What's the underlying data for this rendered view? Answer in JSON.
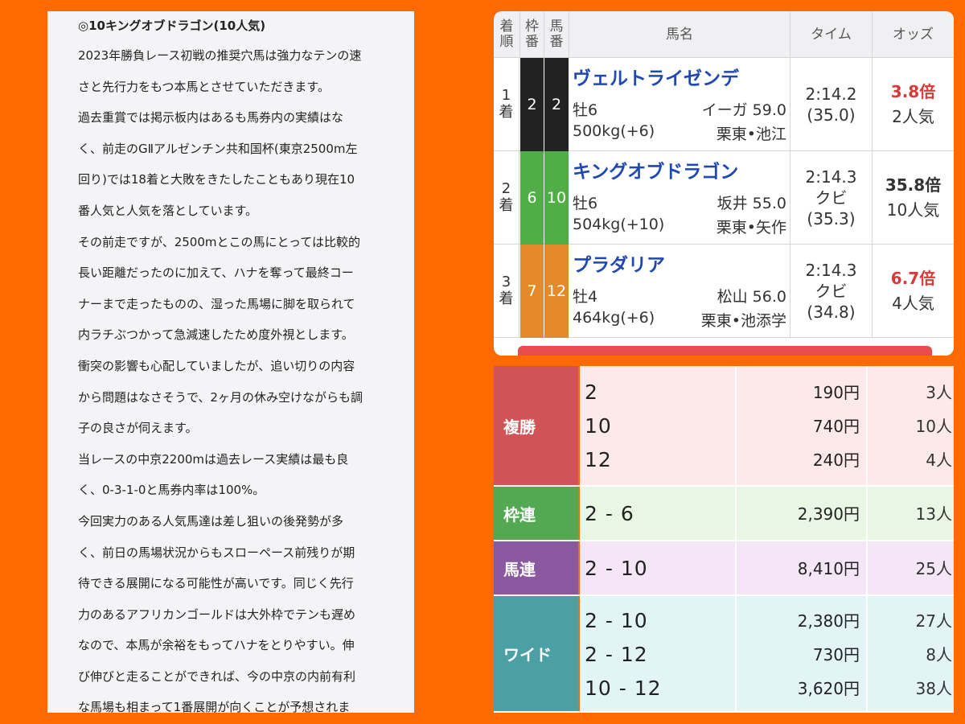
{
  "article": {
    "title": "◎10キングオブドラゴン(10人気)",
    "lines": [
      "2023年勝負レース初戦の推奨穴馬は強力なテンの速",
      "さと先行力をもつ本馬とさせていただきます。",
      "過去重賞では掲示板内はあるも馬券内の実績はな",
      "く、前走のGⅡアルゼンチン共和国杯(東京2500m左",
      "回り)では18着と大敗をきたしたこともあり現在10",
      "番人気と人気を落としています。",
      "その前走ですが、2500mとこの馬にとっては比較的",
      "長い距離だったのに加えて、ハナを奪って最終コー",
      "ナーまで走ったものの、湿った馬場に脚を取られて",
      "内ラチぶつかって急減速したため度外視とします。",
      "衝突の影響も心配していましたが、追い切りの内容",
      "から問題はなさそうで、2ヶ月の休み空けながらも調",
      "子の良さが伺えます。",
      "当レースの中京2200mは過去レース実績は最も良",
      "く、0-3-1-0と馬券内率は100%。",
      "今回実力のある人気馬達は差し狙いの後発勢が多",
      "く、前日の馬場状況からもスローペース前残りが期",
      "待できる展開になる可能性が高いです。同じく先行",
      "力のあるアフリカンゴールドは大外枠でテンも遅め",
      "なので、本馬が余裕をもってハナをとりやすい。伸",
      "び伸びと走ることができれば、今の中京の内前有利",
      "な馬場も相まって1番展開が向くことが予想されま"
    ]
  },
  "results": {
    "headers": {
      "rank_top": "着",
      "rank_bottom": "順",
      "waku_top": "枠",
      "waku_bottom": "番",
      "umaban_top": "馬",
      "umaban_bottom": "番",
      "name": "馬名",
      "time": "タイム",
      "odds": "オッズ"
    },
    "rows": [
      {
        "rank_num": "1",
        "rank_suffix": "着",
        "waku": "2",
        "umaban": "2",
        "waku_color": "#222222",
        "name": "ヴェルトライゼンデ",
        "sex_age": "牡6",
        "jockey": "イーガ 59.0",
        "weight": "500kg(+6)",
        "stable": "栗東•池江",
        "time": "2:14.2",
        "margin": "",
        "last3f": "(35.0)",
        "odds": "3.8倍",
        "odds_color": "#d63a3a",
        "popularity": "2人気"
      },
      {
        "rank_num": "2",
        "rank_suffix": "着",
        "waku": "6",
        "umaban": "10",
        "waku_color": "#4fae45",
        "name": "キングオブドラゴン",
        "sex_age": "牡6",
        "jockey": "坂井 55.0",
        "weight": "504kg(+10)",
        "stable": "栗東•矢作",
        "time": "2:14.3",
        "margin": "クビ",
        "last3f": "(35.3)",
        "odds": "35.8倍",
        "odds_color": "#333333",
        "popularity": "10人気"
      },
      {
        "rank_num": "3",
        "rank_suffix": "着",
        "waku": "7",
        "umaban": "12",
        "waku_color": "#e58a2a",
        "name": "プラダリア",
        "sex_age": "牡4",
        "jockey": "松山 56.0",
        "weight": "464kg(+6)",
        "stable": "栗東•池添学",
        "time": "2:14.3",
        "margin": "クビ",
        "last3f": "(34.8)",
        "odds": "6.7倍",
        "odds_color": "#d63a3a",
        "popularity": "4人気"
      }
    ]
  },
  "payouts": [
    {
      "label": "複勝",
      "label_color": "#cf5357",
      "bg": "#fde8ea",
      "entries": [
        {
          "combo": "2",
          "yen": "190円",
          "ninki": "3人"
        },
        {
          "combo": "10",
          "yen": "740円",
          "ninki": "10人"
        },
        {
          "combo": "12",
          "yen": "240円",
          "ninki": "4人"
        }
      ]
    },
    {
      "label": "枠連",
      "label_color": "#53a952",
      "bg": "#eaf6e4",
      "entries": [
        {
          "combo": "2 - 6",
          "yen": "2,390円",
          "ninki": "13人"
        }
      ]
    },
    {
      "label": "馬連",
      "label_color": "#8a589e",
      "bg": "#f4e6f6",
      "entries": [
        {
          "combo": "2 - 10",
          "yen": "8,410円",
          "ninki": "25人"
        }
      ]
    },
    {
      "label": "ワイド",
      "label_color": "#4aa0a5",
      "bg": "#e2f4f6",
      "entries": [
        {
          "combo": "2 - 10",
          "yen": "2,380円",
          "ninki": "27人"
        },
        {
          "combo": "2 - 12",
          "yen": "730円",
          "ninki": "8人"
        },
        {
          "combo": "10 - 12",
          "yen": "3,620円",
          "ninki": "38人"
        }
      ]
    }
  ]
}
